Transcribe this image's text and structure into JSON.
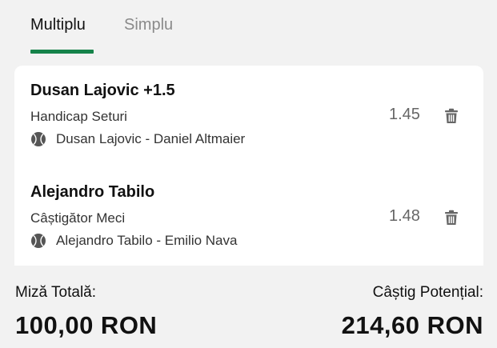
{
  "tabs": [
    {
      "label": "Multiplu",
      "active": true
    },
    {
      "label": "Simplu",
      "active": false
    }
  ],
  "accent_color": "#16834a",
  "bets": [
    {
      "selection": "Dusan Lajovic +1.5",
      "market": "Handicap Seturi",
      "event": "Dusan Lajovic - Daniel Altmaier",
      "odds": "1.45",
      "sport_icon": "tennis-ball-icon",
      "remove_icon": "trash-icon"
    },
    {
      "selection": "Alejandro Tabilo",
      "market": "Câștigător Meci",
      "event": "Alejandro Tabilo - Emilio Nava",
      "odds": "1.48",
      "sport_icon": "tennis-ball-icon",
      "remove_icon": "trash-icon"
    }
  ],
  "summary": {
    "stake_label": "Miză Totală:",
    "stake_value": "100,00 RON",
    "potential_label": "Câștig Potențial:",
    "potential_value": "214,60 RON"
  }
}
